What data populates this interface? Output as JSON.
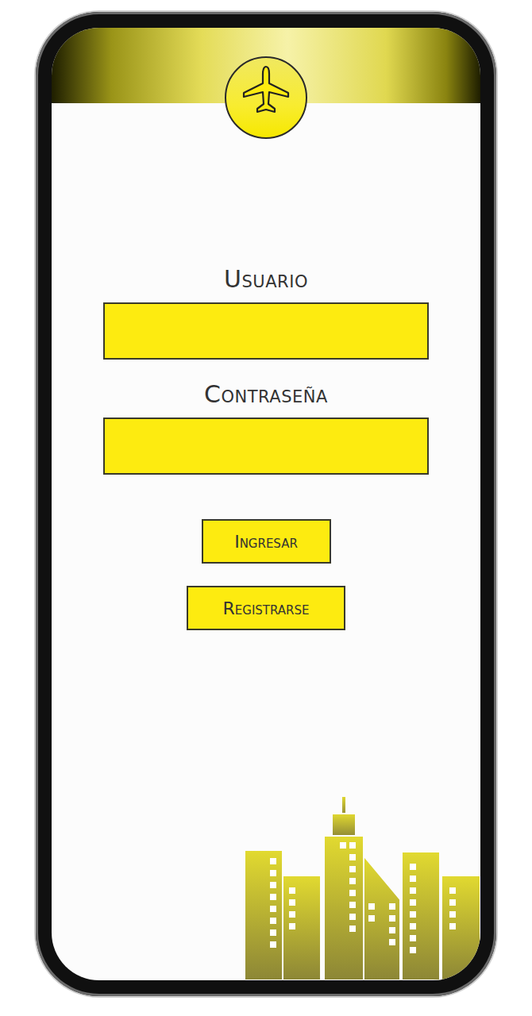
{
  "form": {
    "fields": [
      {
        "label": "Usuario"
      },
      {
        "label": "Contraseña"
      }
    ]
  },
  "buttons": [
    "Ingresar",
    "Registrarse"
  ]
}
